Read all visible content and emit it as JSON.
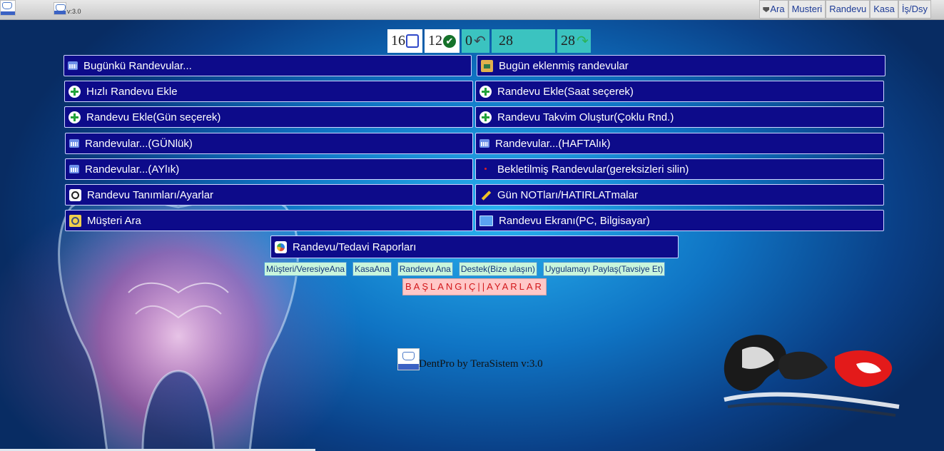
{
  "app": {
    "version_top": "v:3.0"
  },
  "topnav": [
    {
      "label": "Ara",
      "icon": "gem-icon"
    },
    {
      "label": "Musteri"
    },
    {
      "label": "Randevu"
    },
    {
      "label": "Kasa"
    },
    {
      "label": "İş/Dsy"
    }
  ],
  "stats": {
    "s1": {
      "value": "16",
      "icon": "checkbox-icon"
    },
    "s2": {
      "value": "12",
      "icon": "check-circle-icon"
    },
    "s3": {
      "value": "0",
      "icon": "reply-icon"
    },
    "s4": {
      "value": "28"
    },
    "s5": {
      "value": "28",
      "icon": "forward-icon"
    }
  },
  "buttons": {
    "bugunku": "Bugünkü Randevular...",
    "bugun_eklenmis": "Bugün eklenmiş randevular",
    "hizli_ekle": "Hızlı Randevu Ekle",
    "ekle_saat": "Randevu Ekle(Saat seçerek)",
    "ekle_gun": "Randevu Ekle(Gün seçerek)",
    "takvim": "Randevu Takvim Oluştur(Çoklu Rnd.)",
    "gunluk": "Randevular...(GÜNlük)",
    "haftalik": "Randevular...(HAFTAlık)",
    "aylik": "Randevular...(AYlık)",
    "bekletilmis": "Bekletilmiş Randevular(gereksizleri silin)",
    "tanimlar": "Randevu Tanımları/Ayarlar",
    "notlar": "Gün NOTları/HATIRLATmalar",
    "musteri_ara": "Müşteri Ara",
    "ekran": "Randevu Ekranı(PC, Bilgisayar)",
    "raporlar": "Randevu/Tedavi Raporları"
  },
  "links": [
    "Müşteri/VeresiyeAna",
    "KasaAna",
    "Randevu Ana",
    "Destek(Bize ulaşın)",
    "Uygulamayı Paylaş(Tavsiye Et)"
  ],
  "setup_label": "BAŞLANGIÇ||AYARLAR",
  "footer": {
    "text": "DentPro by TeraSistem v:3.0"
  },
  "colors": {
    "button_bg": "#0d0b8a",
    "stat_teal": "#3bc3c0",
    "link_bg": "#c8f5dc",
    "setup_bg": "#ffc8c8"
  }
}
